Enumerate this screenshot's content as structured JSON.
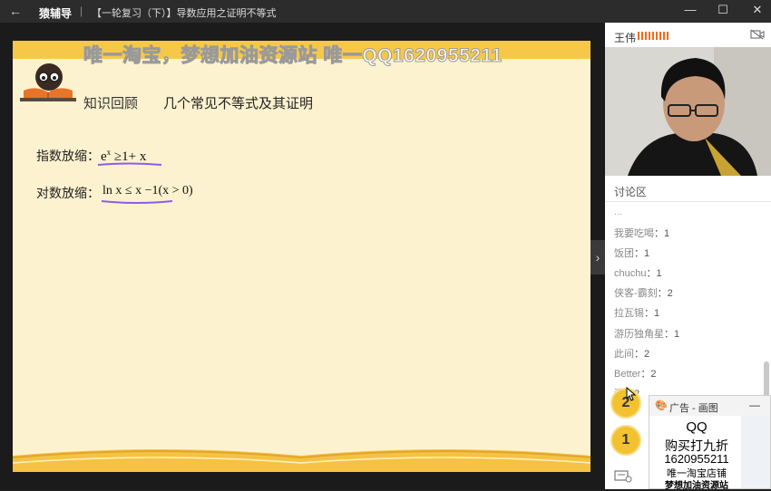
{
  "window": {
    "back_glyph": "←",
    "app_name": "猿辅导",
    "separator": "|",
    "course_title": "【一轮复习（下）】导数应用之证明不等式",
    "controls": {
      "minimize": "—",
      "maximize": "☐",
      "close": "✕"
    }
  },
  "watermark": "唯一淘宝，梦想加油资源站  唯一QQ1620955211",
  "slide": {
    "section": "知识回顾",
    "title": "几个常见不等式及其证明",
    "rows": [
      {
        "label": "指数放缩：",
        "base": "e",
        "sup": "x",
        "rest": " ≥1+ x"
      },
      {
        "label": "对数放缩：",
        "math": "ln x ≤ x −1(x > 0)"
      }
    ]
  },
  "colors": {
    "slide_bg": "#fdf2cf",
    "accent_yellow": "#f6c84a",
    "underline_purple": "#8a5cf0"
  },
  "teacher": {
    "name": "王伟",
    "camera_icon": "camera-off-icon"
  },
  "discussion": {
    "title": "讨论区",
    "truncated_top": "...",
    "messages": [
      {
        "name": "我要吃喝",
        "text": "1"
      },
      {
        "name": "饭团",
        "text": "1"
      },
      {
        "name": "chuchu",
        "text": "1"
      },
      {
        "name": "侠客-霸刻",
        "text": "2"
      },
      {
        "name": "拉瓦锡",
        "text": "1"
      },
      {
        "name": "游历独角星",
        "text": "1"
      },
      {
        "name": "此间",
        "text": "2"
      },
      {
        "name": "Better",
        "text": "2"
      },
      {
        "name": "清",
        "text": "2"
      }
    ]
  },
  "badges": [
    "2",
    "1"
  ],
  "ad": {
    "title": "广告 - 画图",
    "minimize": "—",
    "lines": [
      "QQ",
      "购买打九折",
      "1620955211",
      "唯一淘宝店铺",
      "梦想加油资源站"
    ]
  }
}
